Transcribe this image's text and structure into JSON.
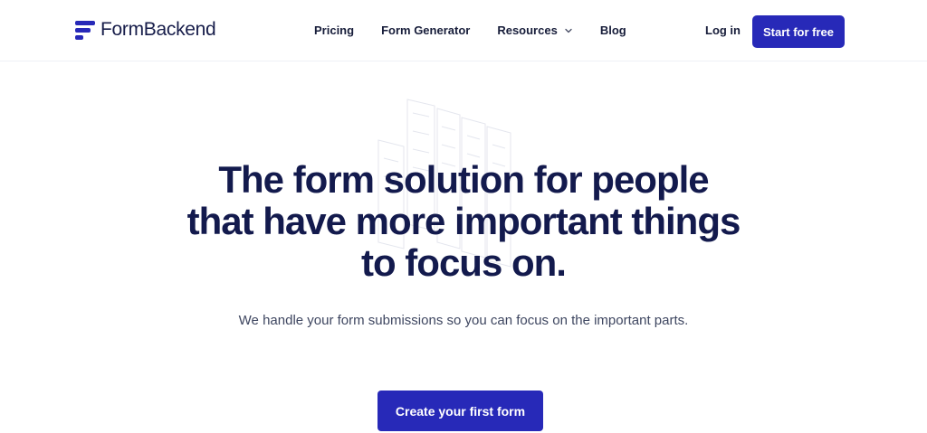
{
  "brand": {
    "name": "FormBackend",
    "primary_color": "#2729b8",
    "text_color": "#131a4d"
  },
  "header": {
    "nav": [
      {
        "label": "Pricing"
      },
      {
        "label": "Form Generator"
      },
      {
        "label": "Resources",
        "icon": "chevron-down-icon"
      },
      {
        "label": "Blog"
      }
    ],
    "login_label": "Log in",
    "cta_label": "Start for free"
  },
  "hero": {
    "title_line1": "The form solution for people",
    "title_line2": "that have more important things",
    "title_line3": "to focus on.",
    "subtitle": "We handle your form submissions so you can focus on the important parts.",
    "cta_label": "Create your first form"
  }
}
